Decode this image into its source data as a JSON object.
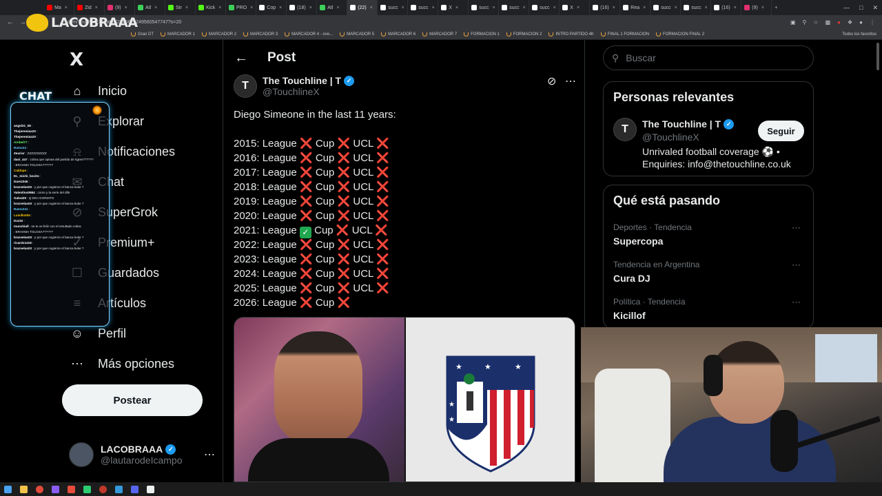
{
  "browser": {
    "tabs": [
      {
        "label": "Ma",
        "color": "#ff0000"
      },
      {
        "label": "Zid",
        "color": "#ff0000"
      },
      {
        "label": "(9)",
        "color": "#e1306c"
      },
      {
        "label": "Atl",
        "color": "#3ecf5a"
      },
      {
        "label": "Str",
        "color": "#53fc18"
      },
      {
        "label": "Kick",
        "color": "#53fc18"
      },
      {
        "label": "PRO",
        "color": "#3ecf5a"
      },
      {
        "label": "Cop",
        "color": "#ffffff"
      },
      {
        "label": "(18)",
        "color": "#ffffff"
      },
      {
        "label": "Atl",
        "color": "#3ecf5a"
      },
      {
        "label": "(22)",
        "color": "#ffffff"
      },
      {
        "label": "succ",
        "color": "#ffffff"
      },
      {
        "label": "succ",
        "color": "#ffffff"
      },
      {
        "label": "X",
        "color": "#ffffff"
      },
      {
        "label": "succ",
        "color": "#ffffff"
      },
      {
        "label": "succ",
        "color": "#ffffff"
      },
      {
        "label": "succ",
        "color": "#ffffff"
      },
      {
        "label": "X",
        "color": "#ffffff"
      },
      {
        "label": "(16)",
        "color": "#ffffff"
      },
      {
        "label": "Rea",
        "color": "#ffffff"
      },
      {
        "label": "succ",
        "color": "#ffffff"
      },
      {
        "label": "succ",
        "color": "#ffffff"
      },
      {
        "label": "(16)",
        "color": "#ffffff"
      },
      {
        "label": "(9)",
        "color": "#e1306c"
      }
    ],
    "active_tab_index": 10,
    "url": ".com/TouchlineX/status/2045623249560547747?s=20",
    "bookmarks": [
      "Gran DT",
      "MARCADOR 1",
      "MARCADOR 2",
      "MARCADOR 3",
      "MARCADOR 4 - ove...",
      "MARCADOR 5",
      "MARCADOR 6",
      "MARCADOR 7",
      "FORMACION 1",
      "FORMACION 2",
      "INTRO PARTIDO 4K",
      "FINAL 1 FORMACION",
      "FORMACION FINAL 2"
    ],
    "bookmarks_right": "Todos los favoritos"
  },
  "stream": {
    "logo_text": "LACOBRAAA",
    "chat_title": "CHAT",
    "chat_lines": [
      {
        "user": "",
        "text": "",
        "color": "#ff4d4d"
      },
      {
        "user": "angel21_08",
        "text": ":",
        "color": "#ffffff"
      },
      {
        "user": "Thejeremias20",
        "text": ":",
        "color": "#ffffff"
      },
      {
        "user": "Thejeremias20",
        "text": ":",
        "color": "#ffffff"
      },
      {
        "user": "",
        "text": "",
        "color": "#ff4d4d"
      },
      {
        "user": "",
        "text": "",
        "color": "#ff4d4d"
      },
      {
        "user": "Arnbel77",
        "text": ":",
        "color": "#66ff66"
      },
      {
        "user": "",
        "text": "",
        "color": "#ff4d4d"
      },
      {
        "user": "Ramo24",
        "text": ":",
        "color": "#66ccff"
      },
      {
        "user": "Zeurior",
        "text": ": ZZZZZZZZZZ",
        "color": "#ffffff"
      },
      {
        "user": "dani_447",
        "text": ": cobra que opinas del partido de tigres??????",
        "color": "#ffffff"
      },
      {
        "user": "",
        "text": ": BRAHMA TOLOSA??????",
        "color": "#ff4d4d"
      },
      {
        "user": "Caldope",
        "text": ":",
        "color": "#ffcc00"
      },
      {
        "user": "EL_michi_bocito",
        "text": ":",
        "color": "#ffffff"
      },
      {
        "user": "Dare2345",
        "text": ":",
        "color": "#ffffff"
      },
      {
        "user": "brazvelas03",
        "text": ": y por que cogieron el banca kuke ?",
        "color": "#ffffff"
      },
      {
        "user": "",
        "text": "",
        "color": "#66ccff"
      },
      {
        "user": "Valentino0984",
        "text": ": como y la serie del dife",
        "color": "#ffffff"
      },
      {
        "user": "",
        "text": "",
        "color": "#ffffff"
      },
      {
        "user": "Galo429",
        "text": ": Q DICI GORDITO",
        "color": "#ffffff"
      },
      {
        "user": "brazvelas03",
        "text": ": y por que cogieron el banca kuke ?",
        "color": "#ffffff"
      },
      {
        "user": "Ramo241",
        "text": ":",
        "color": "#66ccff"
      },
      {
        "user": "Luisillo005",
        "text": ":",
        "color": "#ffcc00"
      },
      {
        "user": "Dvz32",
        "text": ":",
        "color": "#ffffff"
      },
      {
        "user": "munchiull",
        "text": ": se te ve feliz con el resultado cobra",
        "color": "#ffffff"
      },
      {
        "user": "",
        "text": ": BRAHMA TOLOSA??????",
        "color": "#ff4d4d"
      },
      {
        "user": "brazvelas03",
        "text": ": y por que cogieron el banca kuke ?",
        "color": "#ffffff"
      },
      {
        "user": "ricardo1418",
        "text": ":",
        "color": "#ffffff"
      },
      {
        "user": "brazvelas03",
        "text": ": y por que cogieron el banca kuke ?",
        "color": "#ffffff"
      }
    ]
  },
  "leftnav": {
    "logo": "X",
    "items": [
      {
        "label": "Inicio",
        "icon": "home-icon"
      },
      {
        "label": "Explorar",
        "icon": "search-icon"
      },
      {
        "label": "Notificaciones",
        "icon": "bell-icon"
      },
      {
        "label": "Chat",
        "icon": "chat-icon"
      },
      {
        "label": "SuperGrok",
        "icon": "grok-icon"
      },
      {
        "label": "Premium+",
        "icon": "premium-icon"
      },
      {
        "label": "Guardados",
        "icon": "bookmark-icon"
      },
      {
        "label": "Artículos",
        "icon": "articles-icon"
      },
      {
        "label": "Perfil",
        "icon": "profile-icon"
      },
      {
        "label": "Más opciones",
        "icon": "more-options-icon"
      }
    ],
    "post_button": "Postear",
    "profile": {
      "name": "LACOBRAAA",
      "handle": "@lautarodeIcampo"
    }
  },
  "post": {
    "header_title": "Post",
    "author_name": "The Touchline | T",
    "author_handle": "@TouchlineX",
    "avatar_letter": "T",
    "text_intro": "Diego Simeone in the last 11 years:",
    "seasons": [
      {
        "year": "2015:",
        "league": false,
        "cup": false,
        "ucl": false
      },
      {
        "year": "2016:",
        "league": false,
        "cup": false,
        "ucl": false
      },
      {
        "year": "2017:",
        "league": false,
        "cup": false,
        "ucl": false
      },
      {
        "year": "2018:",
        "league": false,
        "cup": false,
        "ucl": false
      },
      {
        "year": "2019:",
        "league": false,
        "cup": false,
        "ucl": false
      },
      {
        "year": "2020:",
        "league": false,
        "cup": false,
        "ucl": false
      },
      {
        "year": "2021:",
        "league": true,
        "cup": false,
        "ucl": false
      },
      {
        "year": "2022:",
        "league": false,
        "cup": false,
        "ucl": false
      },
      {
        "year": "2023:",
        "league": false,
        "cup": false,
        "ucl": false
      },
      {
        "year": "2024:",
        "league": false,
        "cup": false,
        "ucl": false
      },
      {
        "year": "2025:",
        "league": false,
        "cup": false,
        "ucl": false
      },
      {
        "year": "2026:",
        "league": false,
        "cup": false,
        "ucl": null
      }
    ],
    "labels": {
      "league": "League",
      "cup": "Cup",
      "ucl": "UCL"
    }
  },
  "sidebar": {
    "search_placeholder": "Buscar",
    "relevant_title": "Personas relevantes",
    "relevant": {
      "name": "The Touchline | T",
      "handle": "@TouchlineX",
      "bio": "Unrivaled football coverage ⚽ • Enquiries: info@thetouchline.co.uk",
      "follow_label": "Seguir",
      "avatar_letter": "T"
    },
    "trending_title": "Qué está pasando",
    "trends": [
      {
        "meta": "Deportes · Tendencia",
        "name": "Supercopa"
      },
      {
        "meta": "Tendencia en Argentina",
        "name": "Cura DJ"
      },
      {
        "meta": "Política · Tendencia",
        "name": "Kicillof"
      }
    ]
  },
  "colors": {
    "accent": "#1d9bf0",
    "cross": "#f4212e",
    "check": "#1fa74f"
  }
}
